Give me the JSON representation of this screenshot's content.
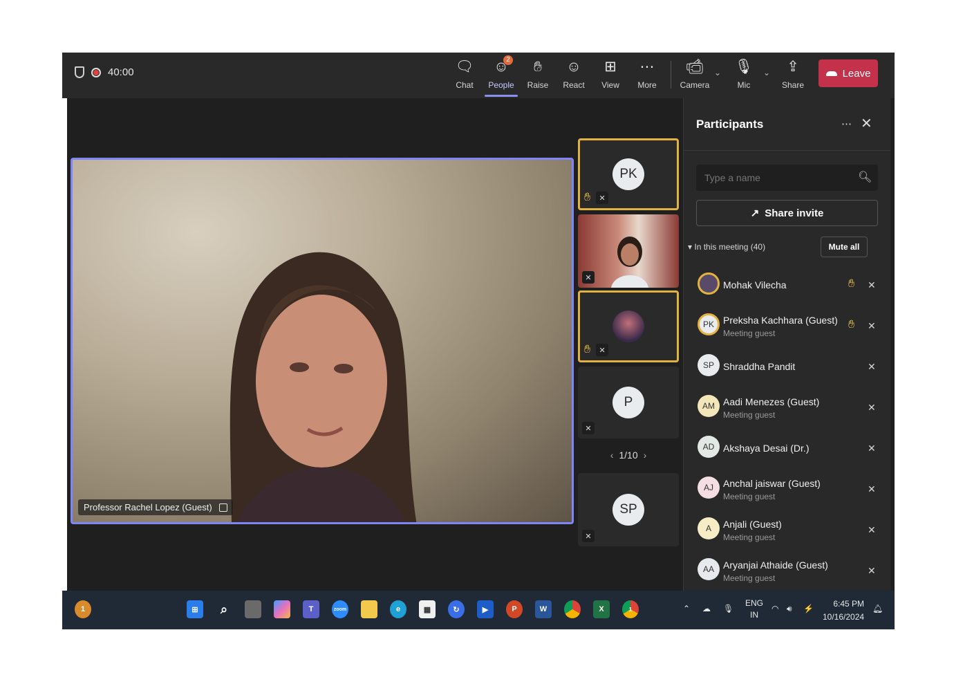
{
  "meeting": {
    "timer": "40:00"
  },
  "toolbar": {
    "chat": "Chat",
    "people": "People",
    "people_badge": "2",
    "raise": "Raise",
    "react": "React",
    "view": "View",
    "more": "More",
    "camera": "Camera",
    "mic": "Mic",
    "share": "Share",
    "leave": "Leave"
  },
  "main_video": {
    "name": "Professor Rachel Lopez (Guest)"
  },
  "tiles": [
    {
      "initials": "PK"
    },
    {
      "initials": ""
    },
    {
      "initials": ""
    },
    {
      "initials": "P"
    },
    {
      "initials": "SP"
    }
  ],
  "pager": {
    "label": "1/10"
  },
  "panel": {
    "title": "Participants",
    "search_placeholder": "Type a name",
    "share_invite": "Share invite",
    "in_meeting": "In this meeting (40)",
    "mute_all": "Mute all",
    "participants": [
      {
        "initials": "",
        "name": "Mohak Vilecha",
        "sub": "",
        "hand": true,
        "color": "#5a4a6a"
      },
      {
        "initials": "PK",
        "name": "Preksha Kachhara (Guest)",
        "sub": "Meeting guest",
        "hand": true,
        "color": "#e8ecef"
      },
      {
        "initials": "SP",
        "name": "Shraddha Pandit",
        "sub": "",
        "hand": false,
        "color": "#e8ecef"
      },
      {
        "initials": "AM",
        "name": "Aadi Menezes (Guest)",
        "sub": "Meeting guest",
        "hand": false,
        "color": "#f3e6b8"
      },
      {
        "initials": "AD",
        "name": "Akshaya Desai (Dr.)",
        "sub": "",
        "hand": false,
        "color": "#e2e8e4"
      },
      {
        "initials": "AJ",
        "name": "Anchal jaiswar (Guest)",
        "sub": "Meeting guest",
        "hand": false,
        "color": "#f4dde3"
      },
      {
        "initials": "A",
        "name": "Anjali (Guest)",
        "sub": "Meeting guest",
        "hand": false,
        "color": "#f6ecc6"
      },
      {
        "initials": "AA",
        "name": "Aryanjai Athaide (Guest)",
        "sub": "Meeting guest",
        "hand": false,
        "color": "#e6e9ee"
      }
    ]
  },
  "taskbar": {
    "lang_top": "ENG",
    "lang_bottom": "IN",
    "time": "6:45 PM",
    "date": "10/16/2024",
    "widget_badge": "1",
    "chrome_badge": "1"
  },
  "colors": {
    "accent": "#7f85f5",
    "hand": "#f2c94c",
    "leave": "#c4314b",
    "highlight": "#e3b341"
  }
}
